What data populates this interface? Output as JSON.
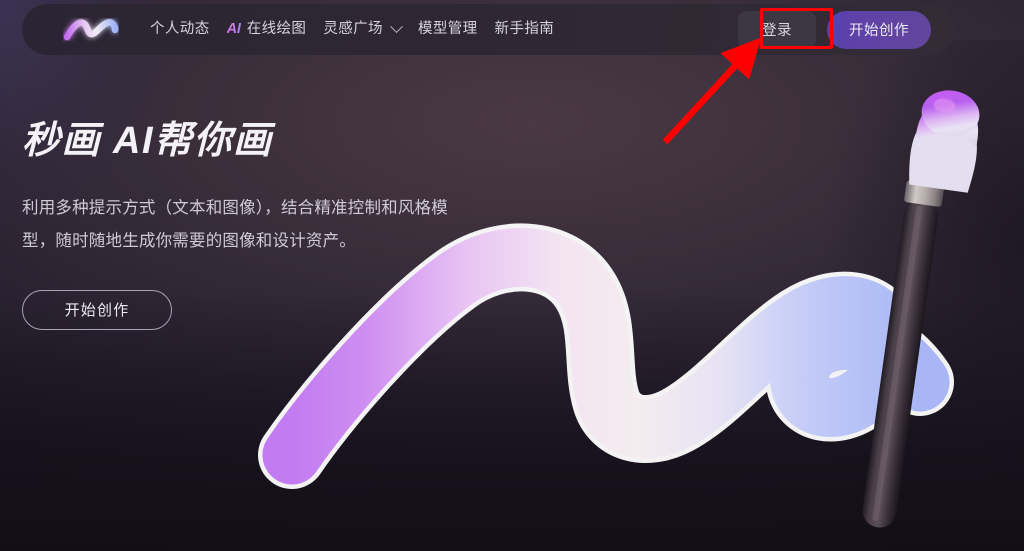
{
  "nav": {
    "logo_name": "miaohua-logo",
    "links": [
      {
        "label": "个人动态",
        "has_chevron": false,
        "prefix": ""
      },
      {
        "label": "在线绘图",
        "has_chevron": false,
        "prefix": "AI"
      },
      {
        "label": "灵感广场",
        "has_chevron": true,
        "prefix": ""
      },
      {
        "label": "模型管理",
        "has_chevron": false,
        "prefix": ""
      },
      {
        "label": "新手指南",
        "has_chevron": false,
        "prefix": ""
      }
    ],
    "login_label": "登录",
    "create_label": "开始创作"
  },
  "hero": {
    "title": "秒画 AI帮你画",
    "description": "利用多种提示方式（文本和图像），结合精准控制和风格模型，随时随地生成你需要的图像和设计资产。",
    "cta_label": "开始创作"
  },
  "annotation": {
    "color": "#ff0000",
    "target": "登录",
    "type": "arrow-and-box"
  },
  "colors": {
    "accent_purple": "#5b3fad",
    "nav_background": "#2e2733",
    "login_background": "#3d3744",
    "page_background": "#1b1622",
    "stroke_start": "#c27bf0",
    "stroke_mid": "#f0e6f5",
    "stroke_end": "#aab8f5",
    "annotation_red": "#ff0000"
  },
  "artwork": {
    "brush_stroke_name": "gradient-brush-stroke",
    "brush_tool_name": "makeup-brush-illustration"
  }
}
